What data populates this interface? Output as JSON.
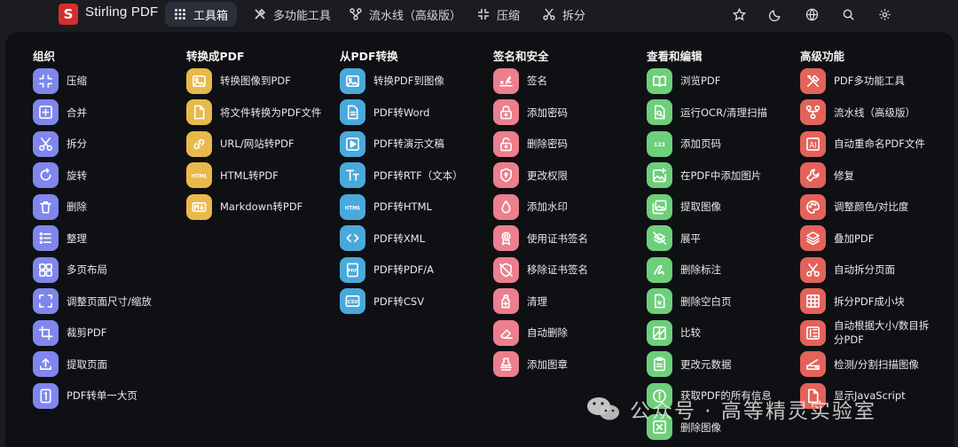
{
  "app": {
    "logo_letter": "S",
    "brand": "Stirling PDF"
  },
  "nav": {
    "toolbox": "工具箱",
    "multitool": "多功能工具",
    "pipeline": "流水线（高级版）",
    "compress": "压缩",
    "split": "拆分"
  },
  "columns": [
    {
      "title": "组织",
      "color": "#7f86ec",
      "items": [
        {
          "label": "压缩",
          "icon": "compress-icon"
        },
        {
          "label": "合并",
          "icon": "merge-icon"
        },
        {
          "label": "拆分",
          "icon": "scissors-icon"
        },
        {
          "label": "旋转",
          "icon": "rotate-icon"
        },
        {
          "label": "删除",
          "icon": "trash-icon"
        },
        {
          "label": "整理",
          "icon": "list-icon"
        },
        {
          "label": "多页布局",
          "icon": "grid-icon"
        },
        {
          "label": "调整页面尺寸/缩放",
          "icon": "resize-icon"
        },
        {
          "label": "裁剪PDF",
          "icon": "crop-icon"
        },
        {
          "label": "提取页面",
          "icon": "upload-icon"
        },
        {
          "label": "PDF转单一大页",
          "icon": "single-page-icon"
        }
      ]
    },
    {
      "title": "转换成PDF",
      "color": "#e8b94b",
      "items": [
        {
          "label": "转换图像到PDF",
          "icon": "image-icon"
        },
        {
          "label": "将文件转换为PDF文件",
          "icon": "file-icon"
        },
        {
          "label": "URL/网站转PDF",
          "icon": "link-icon"
        },
        {
          "label": "HTML转PDF",
          "icon": "html-icon"
        },
        {
          "label": "Markdown转PDF",
          "icon": "markdown-icon"
        }
      ]
    },
    {
      "title": "从PDF转换",
      "color": "#4aa9db",
      "items": [
        {
          "label": "转换PDF到图像",
          "icon": "image-icon"
        },
        {
          "label": "PDF转Word",
          "icon": "document-icon"
        },
        {
          "label": "PDF转演示文稿",
          "icon": "slides-icon"
        },
        {
          "label": "PDF转RTF（文本）",
          "icon": "text-icon"
        },
        {
          "label": "PDF转HTML",
          "icon": "html-icon"
        },
        {
          "label": "PDF转XML",
          "icon": "code-icon"
        },
        {
          "label": "PDF转PDF/A",
          "icon": "pdfa-icon"
        },
        {
          "label": "PDF转CSV",
          "icon": "csv-icon"
        }
      ]
    },
    {
      "title": "签名和安全",
      "color": "#ec7e8e",
      "items": [
        {
          "label": "签名",
          "icon": "signature-icon"
        },
        {
          "label": "添加密码",
          "icon": "lock-icon"
        },
        {
          "label": "删除密码",
          "icon": "unlock-icon"
        },
        {
          "label": "更改权限",
          "icon": "shield-icon"
        },
        {
          "label": "添加水印",
          "icon": "drop-icon"
        },
        {
          "label": "使用证书签名",
          "icon": "badge-icon"
        },
        {
          "label": "移除证书签名",
          "icon": "shield-off-icon"
        },
        {
          "label": "清理",
          "icon": "sanitize-icon"
        },
        {
          "label": "自动删除",
          "icon": "eraser-icon"
        },
        {
          "label": "添加图章",
          "icon": "stamp-icon"
        }
      ]
    },
    {
      "title": "查看和编辑",
      "color": "#6ccf7a",
      "items": [
        {
          "label": "浏览PDF",
          "icon": "book-icon"
        },
        {
          "label": "运行OCR/清理扫描",
          "icon": "ocr-icon"
        },
        {
          "label": "添加页码",
          "icon": "page-number-icon"
        },
        {
          "label": "在PDF中添加图片",
          "icon": "add-image-icon"
        },
        {
          "label": "提取图像",
          "icon": "images-icon"
        },
        {
          "label": "展平",
          "icon": "flatten-icon"
        },
        {
          "label": "删除标注",
          "icon": "annotation-icon"
        },
        {
          "label": "删除空白页",
          "icon": "blank-page-icon"
        },
        {
          "label": "比较",
          "icon": "compare-icon"
        },
        {
          "label": "更改元数据",
          "icon": "clipboard-icon"
        },
        {
          "label": "获取PDF的所有信息",
          "icon": "info-icon"
        },
        {
          "label": "删除图像",
          "icon": "remove-image-icon"
        }
      ]
    },
    {
      "title": "高级功能",
      "color": "#e3625a",
      "items": [
        {
          "label": "PDF多功能工具",
          "icon": "tools-icon"
        },
        {
          "label": "流水线（高级版）",
          "icon": "pipeline-icon"
        },
        {
          "label": "自动重命名PDF文件",
          "icon": "ai-icon"
        },
        {
          "label": "修复",
          "icon": "wrench-icon"
        },
        {
          "label": "调整颜色/对比度",
          "icon": "palette-icon"
        },
        {
          "label": "叠加PDF",
          "icon": "layers-icon"
        },
        {
          "label": "自动拆分页面",
          "icon": "scissors-icon"
        },
        {
          "label": "拆分PDF成小块",
          "icon": "table-icon"
        },
        {
          "label": "自动根据大小/数目拆分PDF",
          "icon": "split-size-icon"
        },
        {
          "label": "检测/分割扫描图像",
          "icon": "scanner-icon"
        },
        {
          "label": "显示JavaScript",
          "icon": "javascript-icon"
        }
      ]
    }
  ],
  "watermark": "公众号 · 高等精灵实验室"
}
